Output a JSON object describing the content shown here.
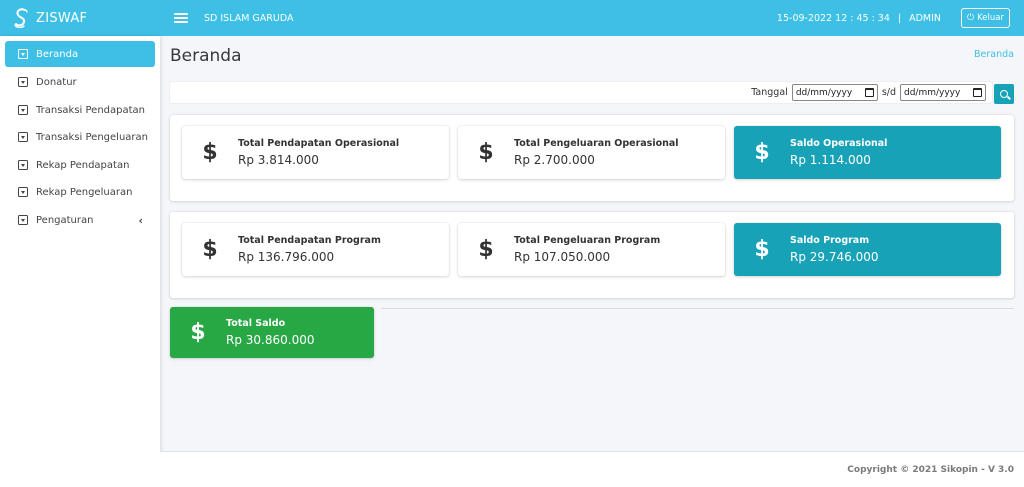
{
  "app": {
    "name": "ZISWAF",
    "school": "SD ISLAM GARUDA"
  },
  "header": {
    "datetime": "15-09-2022 12 : 45 : 34",
    "separator": "|",
    "user": "ADMIN",
    "logout_label": "Keluar"
  },
  "sidebar": {
    "items": [
      {
        "label": "Beranda",
        "active": true
      },
      {
        "label": "Donatur"
      },
      {
        "label": "Transaksi Pendapatan"
      },
      {
        "label": "Transaksi Pengeluaran"
      },
      {
        "label": "Rekap Pendapatan"
      },
      {
        "label": "Rekap Pengeluaran"
      },
      {
        "label": "Pengaturan",
        "expandable": true,
        "chevron": "‹"
      }
    ]
  },
  "page": {
    "title": "Beranda",
    "breadcrumb": "Beranda"
  },
  "filter": {
    "label": "Tanggal",
    "from_placeholder": "dd/mm/yyyy",
    "between": "s/d",
    "to_placeholder": "dd/mm/yyyy"
  },
  "operasional": [
    {
      "label": "Total Pendapatan Operasional",
      "value": "Rp 3.814.000",
      "icon": "$"
    },
    {
      "label": "Total Pengeluaran Operasional",
      "value": "Rp 2.700.000",
      "icon": "$"
    },
    {
      "label": "Saldo Operasional",
      "value": "Rp 1.114.000",
      "icon": "$"
    }
  ],
  "program": [
    {
      "label": "Total Pendapatan Program",
      "value": "Rp 136.796.000",
      "icon": "$"
    },
    {
      "label": "Total Pengeluaran Program",
      "value": "Rp 107.050.000",
      "icon": "$"
    },
    {
      "label": "Saldo Program",
      "value": "Rp 29.746.000",
      "icon": "$"
    }
  ],
  "total": {
    "label": "Total Saldo",
    "value": "Rp 30.860.000",
    "icon": "$"
  },
  "footer": {
    "copyright": "Copyright © 2021 Sikopin - V 3.0"
  },
  "colors": {
    "topbar": "#3ec0e6",
    "teal": "#17a2b8",
    "green": "#28a745"
  }
}
